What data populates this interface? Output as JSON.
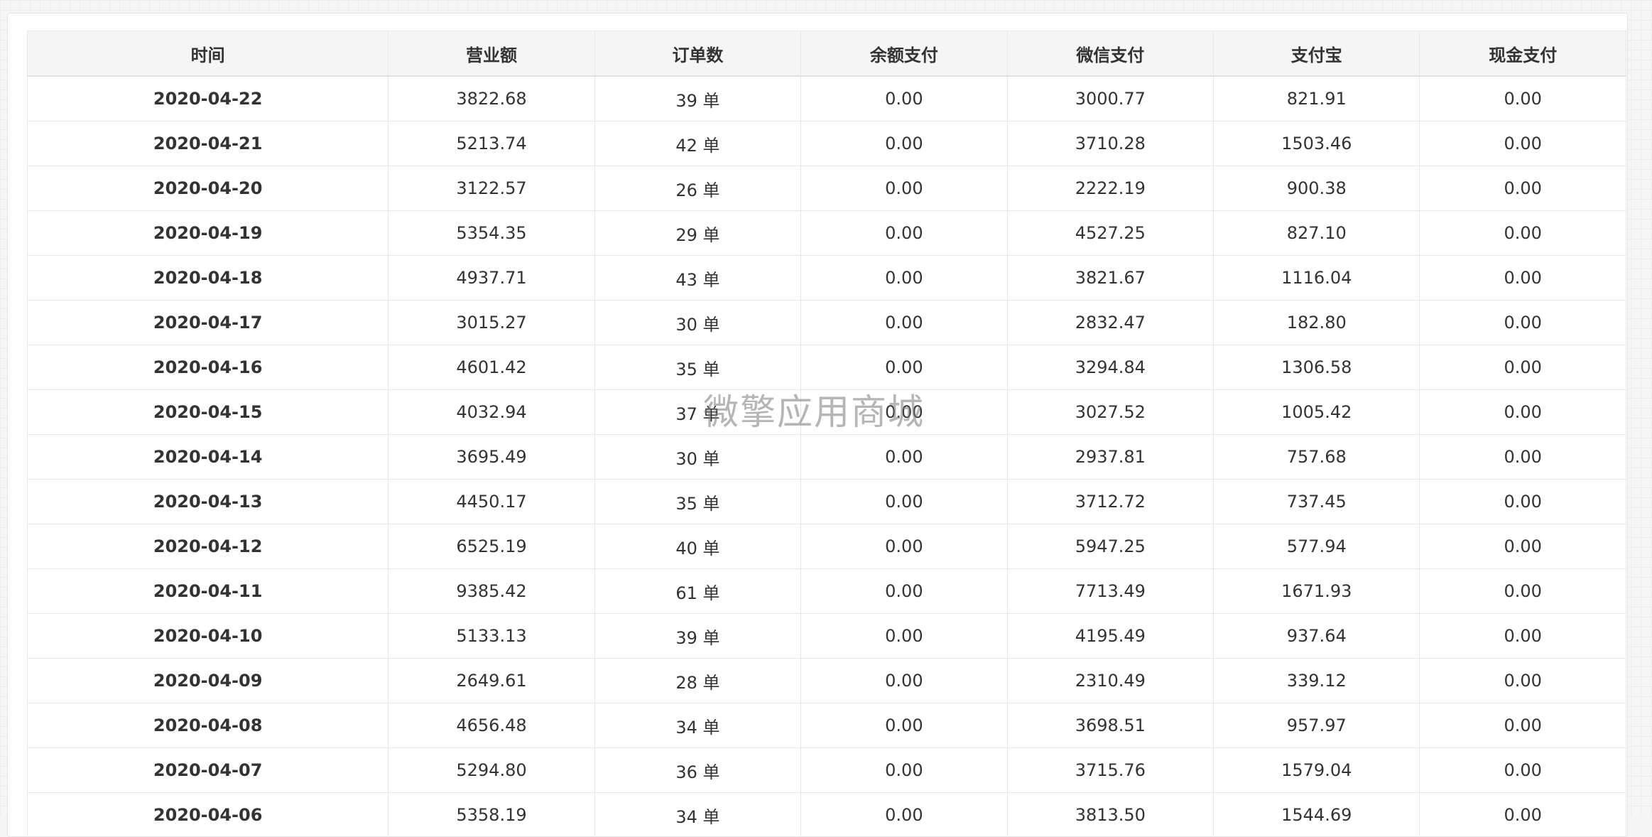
{
  "table": {
    "headers": [
      "时间",
      "营业额",
      "订单数",
      "余额支付",
      "微信支付",
      "支付宝",
      "现金支付"
    ],
    "rows": [
      [
        "2020-04-22",
        "3822.68",
        "39 单",
        "0.00",
        "3000.77",
        "821.91",
        "0.00"
      ],
      [
        "2020-04-21",
        "5213.74",
        "42 单",
        "0.00",
        "3710.28",
        "1503.46",
        "0.00"
      ],
      [
        "2020-04-20",
        "3122.57",
        "26 单",
        "0.00",
        "2222.19",
        "900.38",
        "0.00"
      ],
      [
        "2020-04-19",
        "5354.35",
        "29 单",
        "0.00",
        "4527.25",
        "827.10",
        "0.00"
      ],
      [
        "2020-04-18",
        "4937.71",
        "43 单",
        "0.00",
        "3821.67",
        "1116.04",
        "0.00"
      ],
      [
        "2020-04-17",
        "3015.27",
        "30 单",
        "0.00",
        "2832.47",
        "182.80",
        "0.00"
      ],
      [
        "2020-04-16",
        "4601.42",
        "35 单",
        "0.00",
        "3294.84",
        "1306.58",
        "0.00"
      ],
      [
        "2020-04-15",
        "4032.94",
        "37 单",
        "0.00",
        "3027.52",
        "1005.42",
        "0.00"
      ],
      [
        "2020-04-14",
        "3695.49",
        "30 单",
        "0.00",
        "2937.81",
        "757.68",
        "0.00"
      ],
      [
        "2020-04-13",
        "4450.17",
        "35 单",
        "0.00",
        "3712.72",
        "737.45",
        "0.00"
      ],
      [
        "2020-04-12",
        "6525.19",
        "40 单",
        "0.00",
        "5947.25",
        "577.94",
        "0.00"
      ],
      [
        "2020-04-11",
        "9385.42",
        "61 单",
        "0.00",
        "7713.49",
        "1671.93",
        "0.00"
      ],
      [
        "2020-04-10",
        "5133.13",
        "39 单",
        "0.00",
        "4195.49",
        "937.64",
        "0.00"
      ],
      [
        "2020-04-09",
        "2649.61",
        "28 单",
        "0.00",
        "2310.49",
        "339.12",
        "0.00"
      ],
      [
        "2020-04-08",
        "4656.48",
        "34 单",
        "0.00",
        "3698.51",
        "957.97",
        "0.00"
      ],
      [
        "2020-04-07",
        "5294.80",
        "36 单",
        "0.00",
        "3715.76",
        "1579.04",
        "0.00"
      ],
      [
        "2020-04-06",
        "5358.19",
        "34 单",
        "0.00",
        "3813.50",
        "1544.69",
        "0.00"
      ]
    ]
  },
  "watermark": "微擎应用商城",
  "colors": {
    "header_bg": "#f5f5f5",
    "border": "#e7e7e7",
    "text": "#333333"
  }
}
